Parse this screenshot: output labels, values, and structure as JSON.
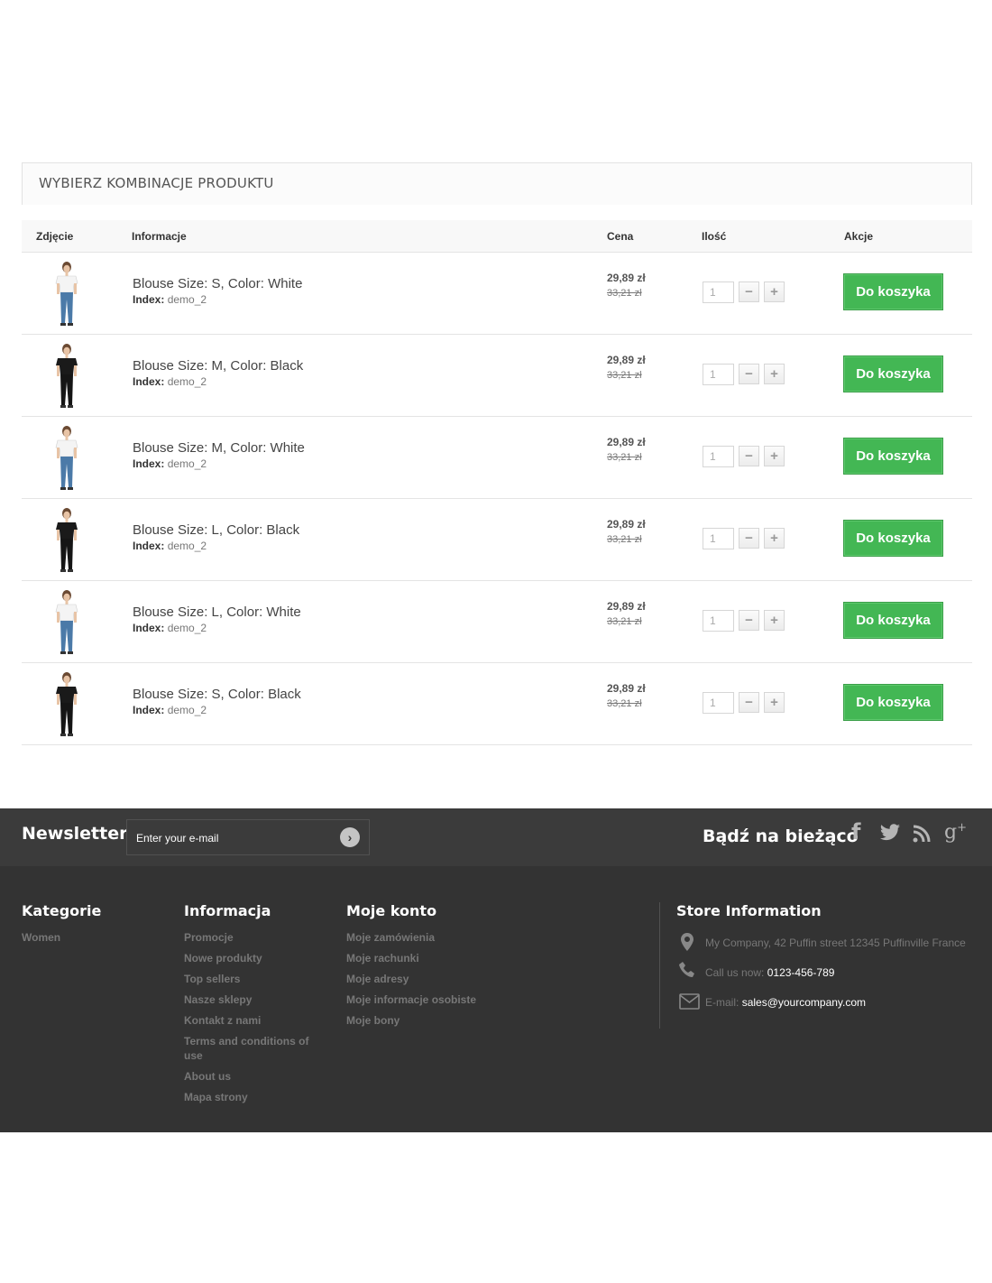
{
  "section_title": "WYBIERZ KOMBINACJE PRODUKTU",
  "table": {
    "headers": {
      "photo": "Zdjęcie",
      "info": "Informacje",
      "price": "Cena",
      "qty": "Ilość",
      "actions": "Akcje"
    },
    "rows": [
      {
        "name": "Blouse Size: S, Color: White",
        "index_label": "Index:",
        "index_value": "demo_2",
        "price": "29,89 zł",
        "old_price": "33,21 zł",
        "qty": "1",
        "button": "Do koszyka",
        "shirt": "white"
      },
      {
        "name": "Blouse Size: M, Color: Black",
        "index_label": "Index:",
        "index_value": "demo_2",
        "price": "29,89 zł",
        "old_price": "33,21 zł",
        "qty": "1",
        "button": "Do koszyka",
        "shirt": "black"
      },
      {
        "name": "Blouse Size: M, Color: White",
        "index_label": "Index:",
        "index_value": "demo_2",
        "price": "29,89 zł",
        "old_price": "33,21 zł",
        "qty": "1",
        "button": "Do koszyka",
        "shirt": "white"
      },
      {
        "name": "Blouse Size: L, Color: Black",
        "index_label": "Index:",
        "index_value": "demo_2",
        "price": "29,89 zł",
        "old_price": "33,21 zł",
        "qty": "1",
        "button": "Do koszyka",
        "shirt": "black"
      },
      {
        "name": "Blouse Size: L, Color: White",
        "index_label": "Index:",
        "index_value": "demo_2",
        "price": "29,89 zł",
        "old_price": "33,21 zł",
        "qty": "1",
        "button": "Do koszyka",
        "shirt": "white"
      },
      {
        "name": "Blouse Size: S, Color: Black",
        "index_label": "Index:",
        "index_value": "demo_2",
        "price": "29,89 zł",
        "old_price": "33,21 zł",
        "qty": "1",
        "button": "Do koszyka",
        "shirt": "black"
      }
    ]
  },
  "newsletter": {
    "title": "Newsletter",
    "placeholder": "Enter your e-mail"
  },
  "follow": {
    "title": "Bądź na bieżąco",
    "icons": [
      "facebook-icon",
      "twitter-icon",
      "rss-icon",
      "google-plus-icon"
    ]
  },
  "footer": {
    "categories": {
      "title": "Kategorie",
      "items": [
        "Women"
      ]
    },
    "information": {
      "title": "Informacja",
      "items": [
        "Promocje",
        "Nowe produkty",
        "Top sellers",
        "Nasze sklepy",
        "Kontakt z nami",
        "Terms and conditions of use",
        "About us",
        "Mapa strony"
      ]
    },
    "account": {
      "title": "Moje konto",
      "items": [
        "Moje zamówienia",
        "Moje rachunki",
        "Moje adresy",
        "Moje informacje osobiste",
        "Moje bony"
      ]
    },
    "store": {
      "title": "Store Information",
      "address": "My Company, 42 Puffin street 12345 Puffinville France",
      "call_label": "Call us now:",
      "phone": "0123-456-789",
      "email_label": "E-mail:",
      "email": "sales@yourcompany.com"
    }
  },
  "colors": {
    "button_green": "#43b754",
    "footer_dark": "#333333",
    "newsletter_bar": "#3b3b3b"
  }
}
